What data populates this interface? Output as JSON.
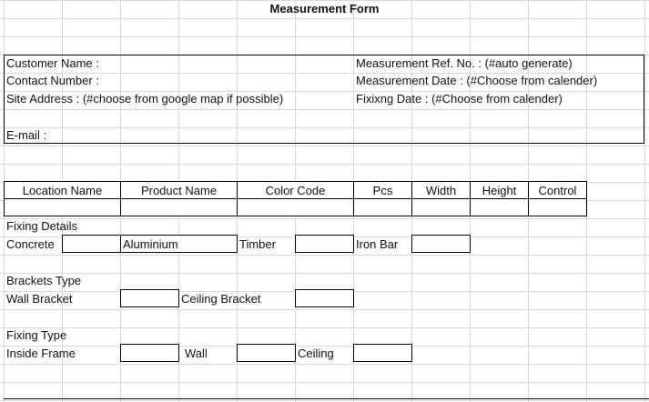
{
  "title": "Measurement Form",
  "info": {
    "customer_name": "Customer Name  :",
    "contact_number": "Contact Number :",
    "site_address": "Site Address : (#choose from google map if possible)",
    "email": "E-mail :",
    "measurement_ref": "Measurement Ref. No. : (#auto generate)",
    "measurement_date": "Measurement Date : (#Choose from calender)",
    "fixing_date": "Fixixng Date : (#Choose from calender)"
  },
  "table_headers": [
    "Location Name",
    "Product Name",
    "Color Code",
    "Pcs",
    "Width",
    "Height",
    "Control"
  ],
  "fixing_details": {
    "heading": "Fixing Details",
    "concrete": "Concrete",
    "aluminium": "Aluminium",
    "timber": "Timber",
    "iron_bar": "Iron Bar"
  },
  "brackets_type": {
    "heading": "Brackets Type",
    "wall_bracket": "Wall Bracket",
    "ceiling_bracket": "Ceiling Bracket"
  },
  "fixing_type": {
    "heading": "Fixing Type",
    "inside_frame": "Inside Frame",
    "wall": "Wall",
    "ceiling": "Ceiling"
  }
}
